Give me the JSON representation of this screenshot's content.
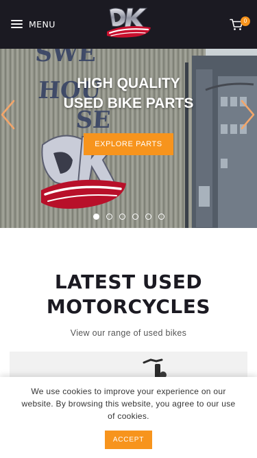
{
  "header": {
    "menu_label": "MENU",
    "logo_alt": "DK Motorcycles",
    "cart_count": "0"
  },
  "hero": {
    "title_line1": "HIGH QUALITY",
    "title_line2": "USED BIKE PARTS",
    "cta_label": "EXPLORE PARTS",
    "slide_count": 6,
    "active_slide": 1
  },
  "latest": {
    "title_line1": "LATEST USED",
    "title_line2": "MOTORCYCLES",
    "subtitle": "View our range of used bikes"
  },
  "cookie": {
    "text": "We use cookies to improve your experience on our website. By browsing this website, you agree to our use of cookies.",
    "accept_label": "ACCEPT"
  },
  "colors": {
    "header_bg": "#1b1a22",
    "accent": "#f7941d",
    "text_dark": "#1b1a22"
  },
  "icons": [
    "hamburger-icon",
    "cart-icon",
    "chevron-left-icon",
    "chevron-right-icon"
  ]
}
